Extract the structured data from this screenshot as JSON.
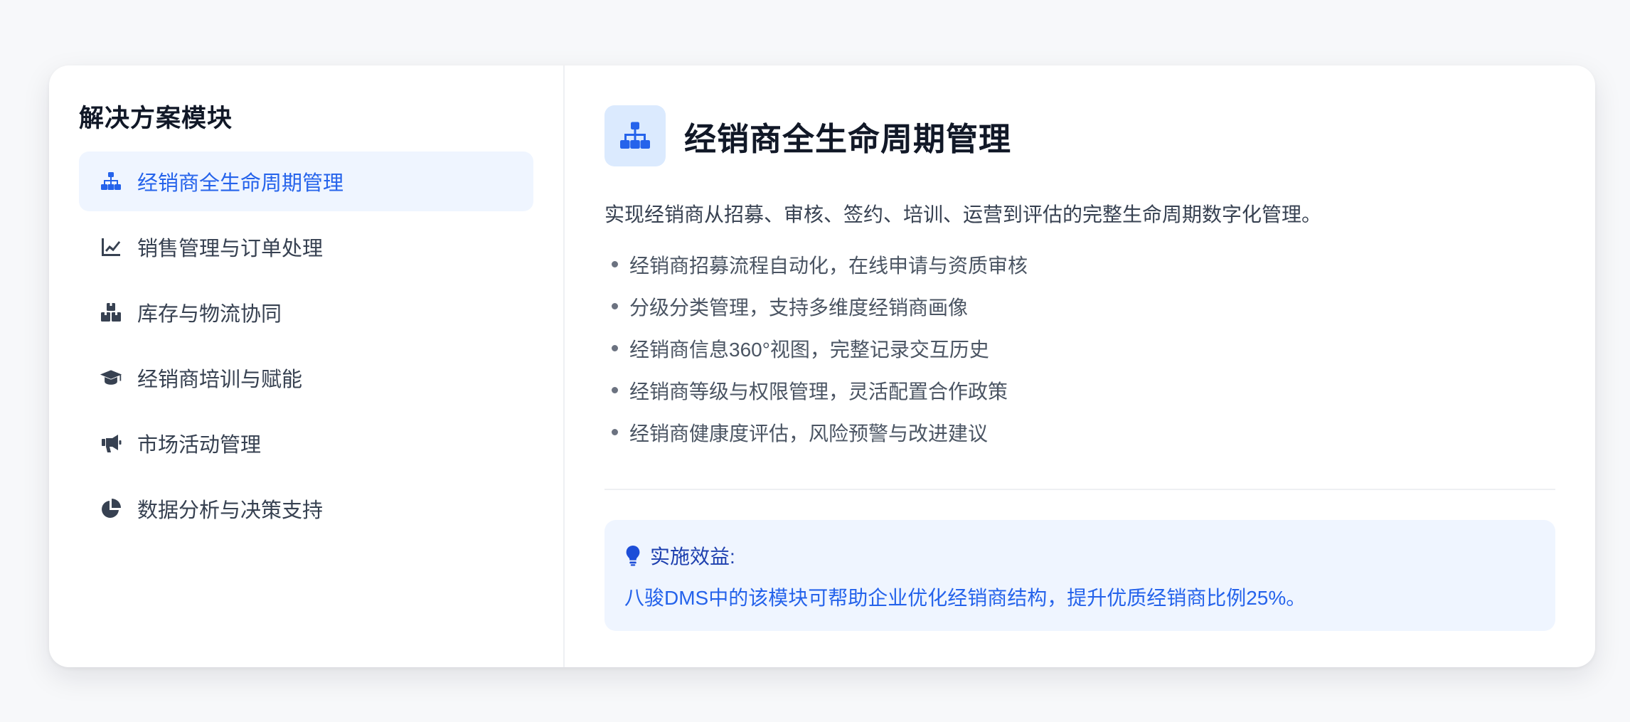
{
  "sidebar": {
    "title": "解决方案模块",
    "items": [
      {
        "label": "经销商全生命周期管理",
        "icon": "sitemap-icon",
        "active": true
      },
      {
        "label": "销售管理与订单处理",
        "icon": "line-chart-icon",
        "active": false
      },
      {
        "label": "库存与物流协同",
        "icon": "boxes-icon",
        "active": false
      },
      {
        "label": "经销商培训与赋能",
        "icon": "graduation-cap-icon",
        "active": false
      },
      {
        "label": "市场活动管理",
        "icon": "megaphone-icon",
        "active": false
      },
      {
        "label": "数据分析与决策支持",
        "icon": "pie-chart-icon",
        "active": false
      }
    ]
  },
  "main": {
    "icon": "sitemap-icon",
    "title": "经销商全生命周期管理",
    "description": "实现经销商从招募、审核、签约、培训、运营到评估的完整生命周期数字化管理。",
    "bullets": [
      "经销商招募流程自动化，在线申请与资质审核",
      "分级分类管理，支持多维度经销商画像",
      "经销商信息360°视图，完整记录交互历史",
      "经销商等级与权限管理，灵活配置合作政策",
      "经销商健康度评估，风险预警与改进建议"
    ],
    "benefit": {
      "icon": "lightbulb-icon",
      "heading": "实施效益:",
      "text": "八骏DMS中的该模块可帮助企业优化经销商结构，提升优质经销商比例25%。"
    }
  },
  "colors": {
    "accent": "#2563eb",
    "accent_bg": "#eff5ff",
    "header_icon_bg": "#dbeafe"
  }
}
